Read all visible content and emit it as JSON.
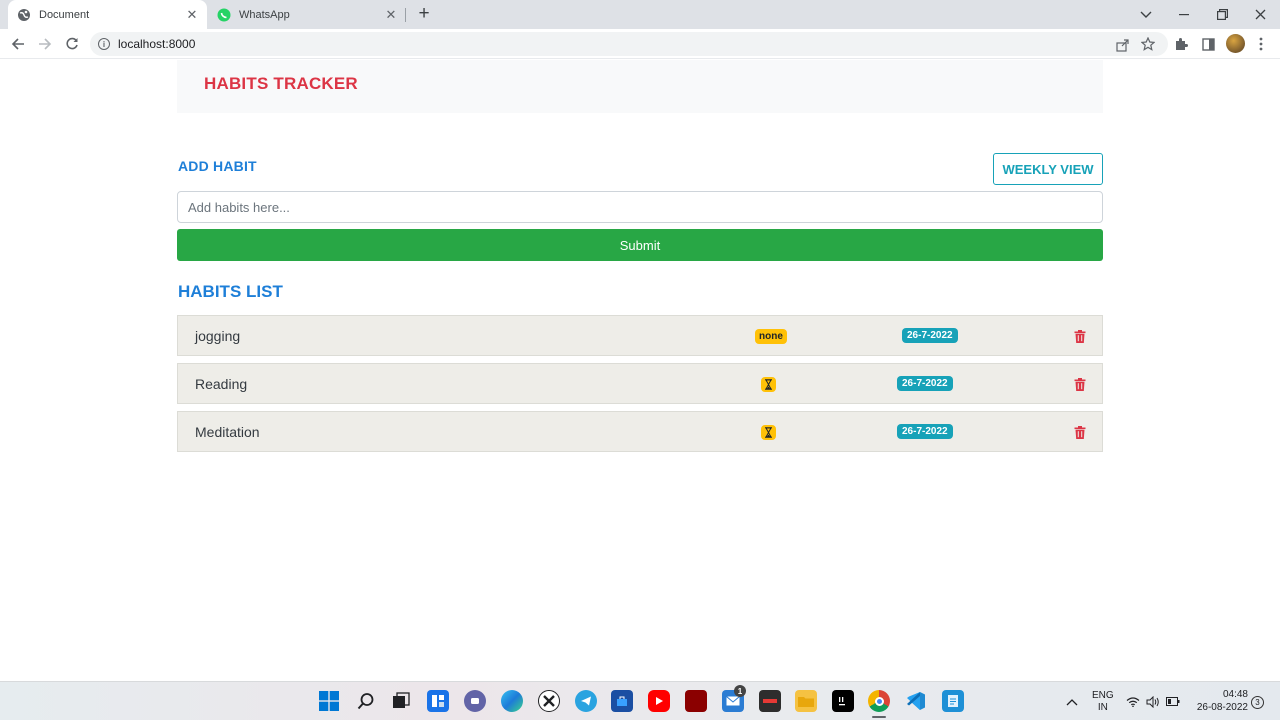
{
  "browser": {
    "tabs": [
      {
        "title": "Document",
        "active": true,
        "icon": "globe-icon"
      },
      {
        "title": "WhatsApp",
        "active": false,
        "icon": "whatsapp-icon"
      }
    ],
    "url": "localhost:8000"
  },
  "app": {
    "brand": "HABITS TRACKER",
    "add_habit_title": "ADD HABIT",
    "weekly_view_label": "WEEKLY VIEW",
    "input_placeholder": "Add habits here...",
    "submit_label": "Submit",
    "habits_list_title": "HABITS LIST",
    "habits": [
      {
        "name": "jogging",
        "status": "none",
        "status_icon": "",
        "date": "26-7-2022"
      },
      {
        "name": "Reading",
        "status": "",
        "status_icon": "hourglass-icon",
        "date": "26-7-2022"
      },
      {
        "name": "Meditation",
        "status": "",
        "status_icon": "hourglass-icon",
        "date": "26-7-2022"
      }
    ],
    "colors": {
      "brand": "#dc3545",
      "heading": "#1e7fd8",
      "submit": "#28a745",
      "date_badge": "#17a2b8",
      "status_badge": "#ffc107",
      "delete": "#dc3545"
    }
  },
  "taskbar": {
    "language": "ENG",
    "region": "IN",
    "time": "04:48",
    "date": "26-08-2022",
    "notification_count": "3",
    "mail_badge": "1"
  }
}
